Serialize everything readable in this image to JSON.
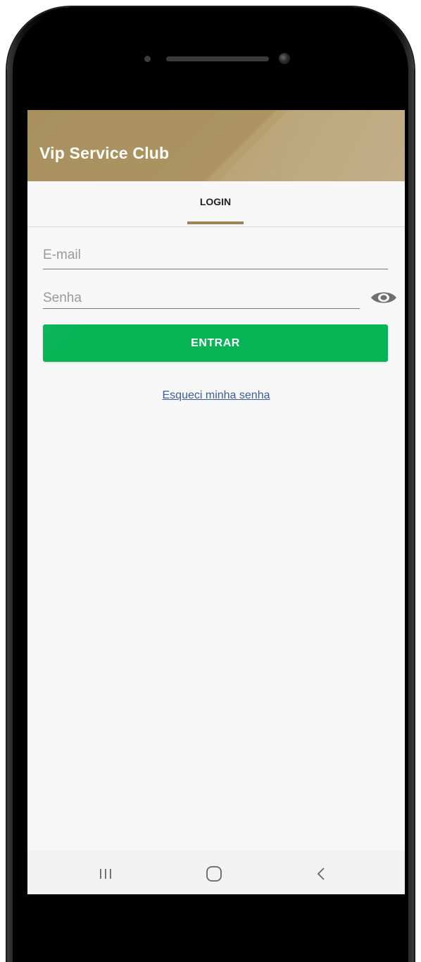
{
  "app": {
    "title": "Vip Service Club"
  },
  "tabs": [
    {
      "label": "LOGIN",
      "selected": true
    }
  ],
  "form": {
    "email_placeholder": "E-mail",
    "email_value": "",
    "password_placeholder": "Senha",
    "password_value": "",
    "submit_label": "ENTRAR",
    "forgot_label": "Esqueci minha senha"
  },
  "icons": {
    "visibility_toggle": "eye-icon",
    "nav_recents": "recents-icon",
    "nav_home": "home-icon",
    "nav_back": "back-icon"
  },
  "colors": {
    "app_bar": "#ab9462",
    "tab_indicator": "#9b8458",
    "submit_button": "#06b455",
    "link": "#3d5d96",
    "screen_background": "#f7f7f7"
  }
}
